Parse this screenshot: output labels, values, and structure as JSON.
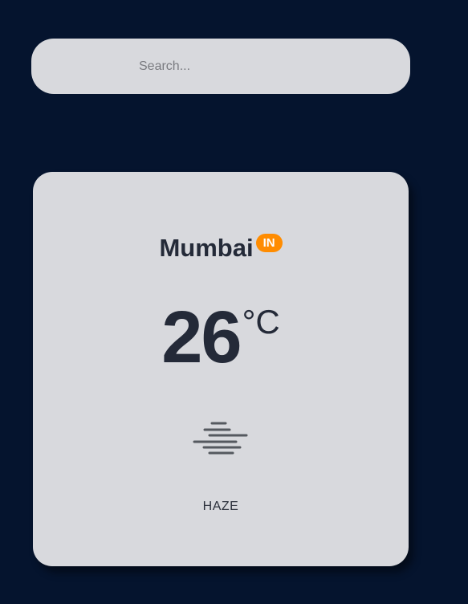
{
  "search": {
    "placeholder": "Search..."
  },
  "weather": {
    "city": "Mumbai",
    "country_code": "IN",
    "temperature": "26",
    "unit": "°C",
    "condition": "HAZE",
    "icon": "haze-icon"
  },
  "colors": {
    "background": "#05142e",
    "card": "#d8d9dd",
    "badge": "#ff8c00",
    "text_dark": "#242a38"
  }
}
